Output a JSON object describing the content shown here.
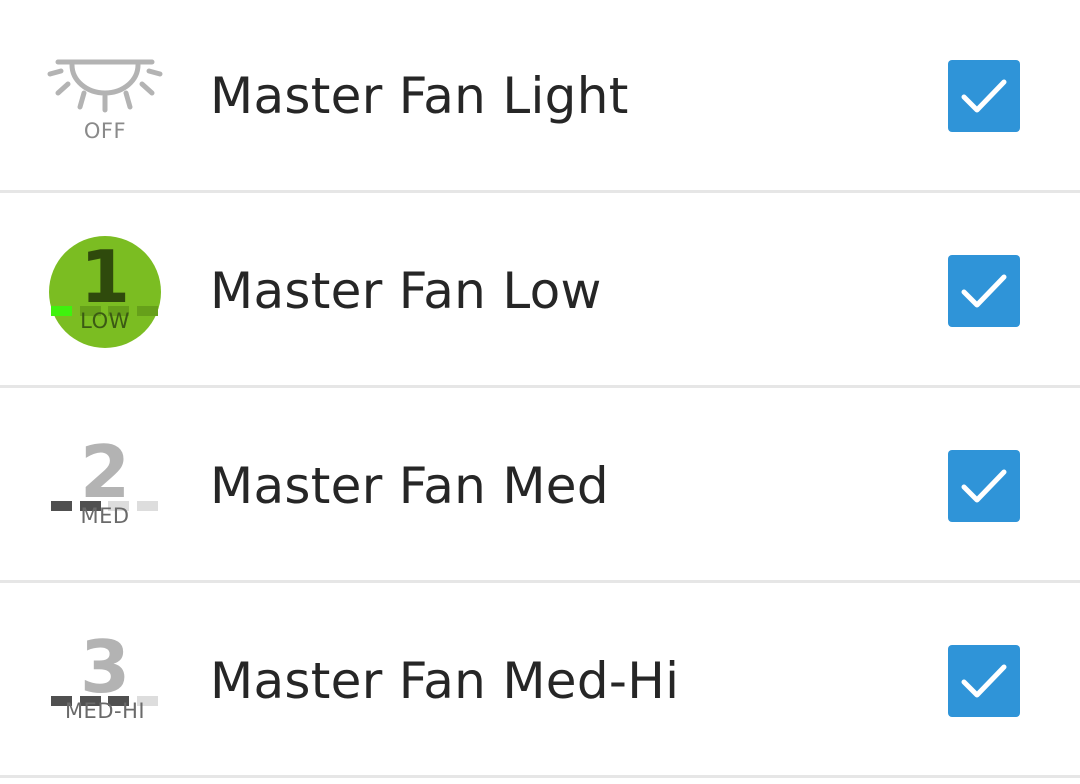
{
  "colors": {
    "check_bg": "#2f94d8",
    "check_mark": "#ffffff",
    "row_divider": "#e6e6e6",
    "active_green": "#7bbd22",
    "active_dark": "#2f4a0c",
    "bar_lit_green": "#3ff20e",
    "inactive_num": "#b3b3b3",
    "bar_dark": "#505050",
    "bar_light": "#dddddd"
  },
  "devices": [
    {
      "name": "Master Fan Light",
      "icon": "bulb-off-icon",
      "icon_text": "OFF",
      "checked": true
    },
    {
      "name": "Master Fan Low",
      "icon": "speed-1-icon",
      "icon_number": "1",
      "icon_text": "LOW",
      "active": true,
      "checked": true
    },
    {
      "name": "Master Fan Med",
      "icon": "speed-2-icon",
      "icon_number": "2",
      "icon_text": "MED",
      "checked": true
    },
    {
      "name": "Master Fan Med-Hi",
      "icon": "speed-3-icon",
      "icon_number": "3",
      "icon_text": "MED-HI",
      "checked": true
    }
  ]
}
